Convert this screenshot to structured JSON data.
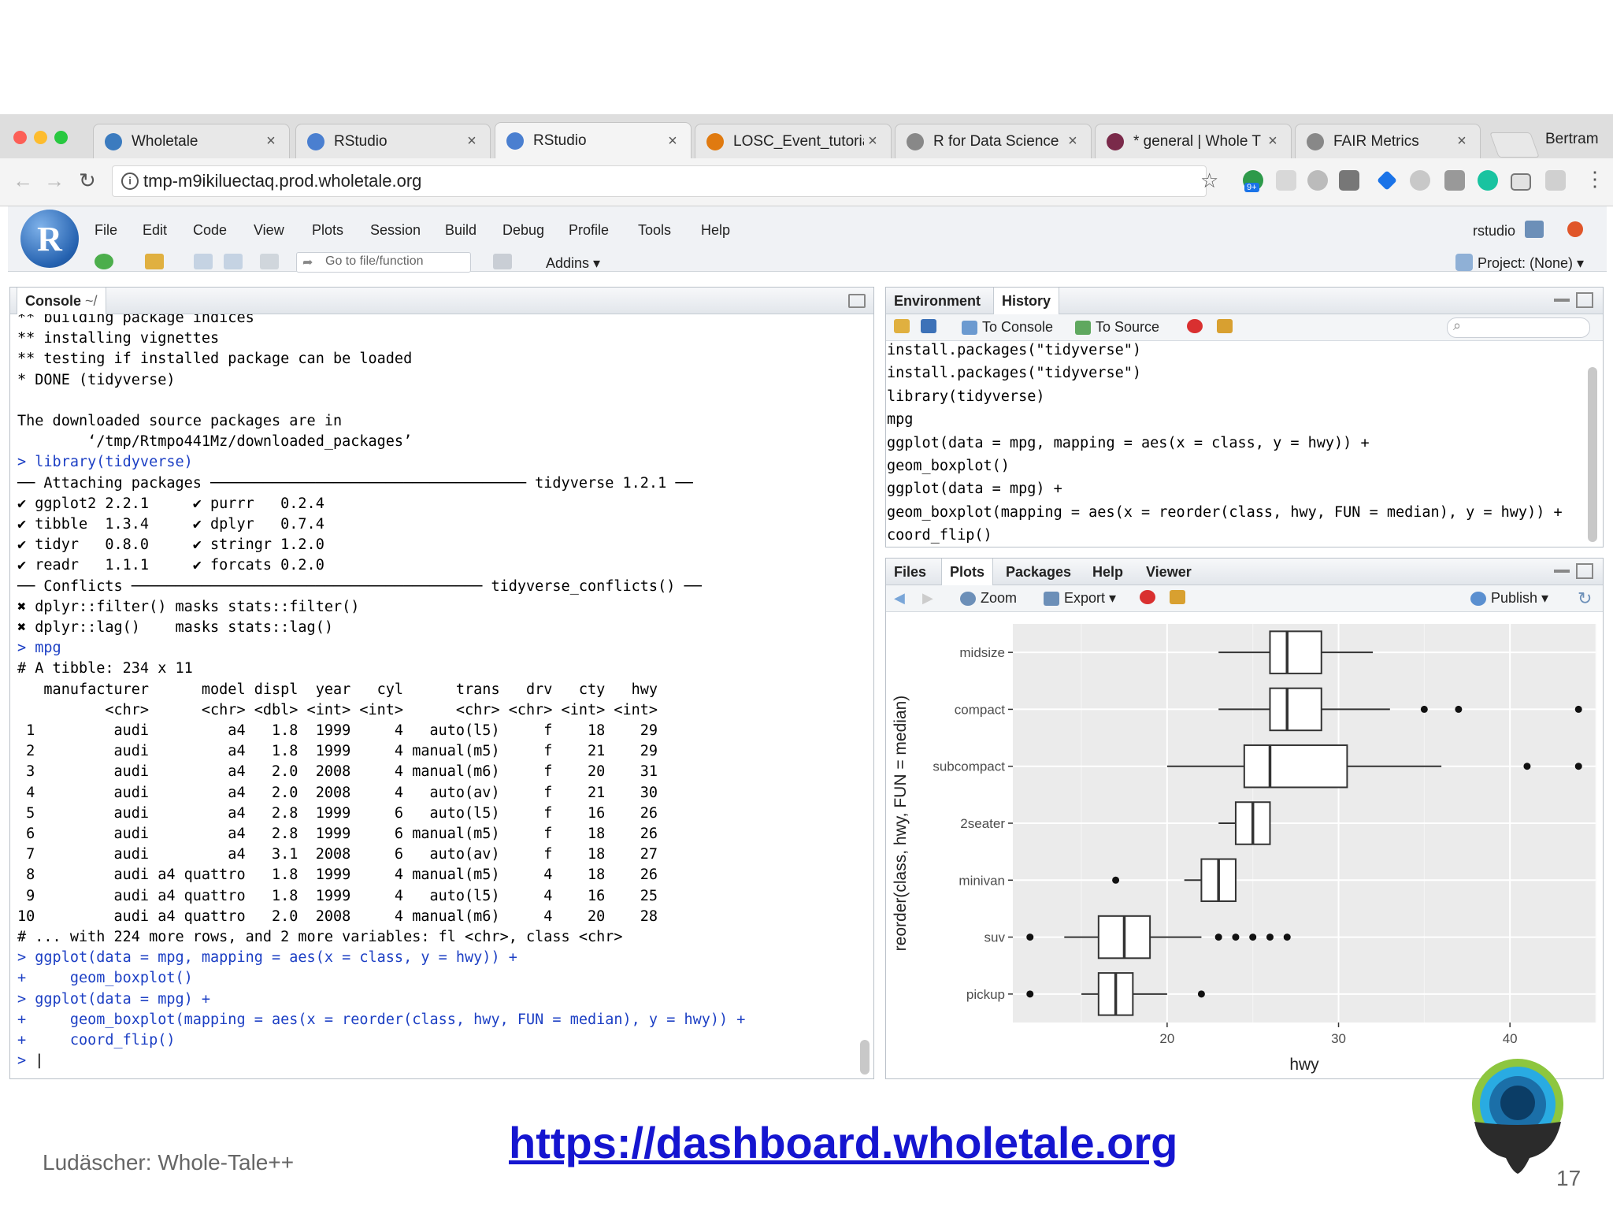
{
  "browser": {
    "tabs": [
      {
        "title": "Wholetale",
        "icon": "globe-icon",
        "color": "#3b7bbf"
      },
      {
        "title": "RStudio",
        "icon": "rstudio-icon",
        "color": "#4a7fd0"
      },
      {
        "title": "RStudio",
        "icon": "rstudio-icon",
        "color": "#4a7fd0"
      },
      {
        "title": "LOSC_Event_tutoria",
        "icon": "notebook-icon",
        "color": "#e07a10"
      },
      {
        "title": "R for Data Science",
        "icon": "document-icon",
        "color": "#888888"
      },
      {
        "title": "* general | Whole T",
        "icon": "slack-icon",
        "color": "#7a2a4a"
      },
      {
        "title": "FAIR Metrics",
        "icon": "document-icon",
        "color": "#888888"
      }
    ],
    "close_glyph": "×",
    "profile_name": "Bertram",
    "url": "tmp-m9ikiluectaq.prod.wholetale.org",
    "ext_badge": "9+"
  },
  "rstudio": {
    "logo_letter": "R",
    "menus": [
      "File",
      "Edit",
      "Code",
      "View",
      "Plots",
      "Session",
      "Build",
      "Debug",
      "Profile",
      "Tools",
      "Help"
    ],
    "goto_placeholder": "Go to file/function",
    "addins_label": "Addins",
    "user": "rstudio",
    "project_label": "Project: (None)"
  },
  "console": {
    "tab_label": "Console",
    "path": "~/",
    "lines": [
      {
        "t": "** building package indices",
        "c": false
      },
      {
        "t": "** installing vignettes",
        "c": false
      },
      {
        "t": "** testing if installed package can be loaded",
        "c": false
      },
      {
        "t": "* DONE (tidyverse)",
        "c": false
      },
      {
        "t": "",
        "c": false
      },
      {
        "t": "The downloaded source packages are in",
        "c": false
      },
      {
        "t": "        ‘/tmp/Rtmpo441Mz/downloaded_packages’",
        "c": false
      },
      {
        "t": "> library(tidyverse)",
        "c": true
      },
      {
        "t": "── Attaching packages ──────────────────────────────────── tidyverse 1.2.1 ──",
        "c": false
      },
      {
        "t": "✔ ggplot2 2.2.1     ✔ purrr   0.2.4",
        "c": false
      },
      {
        "t": "✔ tibble  1.3.4     ✔ dplyr   0.7.4",
        "c": false
      },
      {
        "t": "✔ tidyr   0.8.0     ✔ stringr 1.2.0",
        "c": false
      },
      {
        "t": "✔ readr   1.1.1     ✔ forcats 0.2.0",
        "c": false
      },
      {
        "t": "── Conflicts ──────────────────────────────────────── tidyverse_conflicts() ──",
        "c": false
      },
      {
        "t": "✖ dplyr::filter() masks stats::filter()",
        "c": false
      },
      {
        "t": "✖ dplyr::lag()    masks stats::lag()",
        "c": false
      },
      {
        "t": "> mpg",
        "c": true
      },
      {
        "t": "# A tibble: 234 x 11",
        "c": false
      },
      {
        "t": "   manufacturer      model displ  year   cyl      trans   drv   cty   hwy",
        "c": false
      },
      {
        "t": "          <chr>      <chr> <dbl> <int> <int>      <chr> <chr> <int> <int>",
        "c": false
      },
      {
        "t": " 1         audi         a4   1.8  1999     4   auto(l5)     f    18    29",
        "c": false
      },
      {
        "t": " 2         audi         a4   1.8  1999     4 manual(m5)     f    21    29",
        "c": false
      },
      {
        "t": " 3         audi         a4   2.0  2008     4 manual(m6)     f    20    31",
        "c": false
      },
      {
        "t": " 4         audi         a4   2.0  2008     4   auto(av)     f    21    30",
        "c": false
      },
      {
        "t": " 5         audi         a4   2.8  1999     6   auto(l5)     f    16    26",
        "c": false
      },
      {
        "t": " 6         audi         a4   2.8  1999     6 manual(m5)     f    18    26",
        "c": false
      },
      {
        "t": " 7         audi         a4   3.1  2008     6   auto(av)     f    18    27",
        "c": false
      },
      {
        "t": " 8         audi a4 quattro   1.8  1999     4 manual(m5)     4    18    26",
        "c": false
      },
      {
        "t": " 9         audi a4 quattro   1.8  1999     4   auto(l5)     4    16    25",
        "c": false
      },
      {
        "t": "10         audi a4 quattro   2.0  2008     4 manual(m6)     4    20    28",
        "c": false
      },
      {
        "t": "# ... with 224 more rows, and 2 more variables: fl <chr>, class <chr>",
        "c": false
      },
      {
        "t": "> ggplot(data = mpg, mapping = aes(x = class, y = hwy)) +",
        "c": true
      },
      {
        "t": "+     geom_boxplot()",
        "c": true
      },
      {
        "t": "> ggplot(data = mpg) +",
        "c": true
      },
      {
        "t": "+     geom_boxplot(mapping = aes(x = reorder(class, hwy, FUN = median), y = hwy)) +",
        "c": true
      },
      {
        "t": "+     coord_flip()",
        "c": true
      },
      {
        "t": "> ",
        "c": true
      }
    ]
  },
  "env_pane": {
    "tabs": [
      "Environment",
      "History"
    ],
    "to_console": "To Console",
    "to_source": "To Source",
    "history": [
      "install.packages(\"tidyverse\")",
      "install.packages(\"tidyverse\")",
      "library(tidyverse)",
      "mpg",
      "ggplot(data = mpg, mapping = aes(x = class, y = hwy)) +",
      "geom_boxplot()",
      "ggplot(data = mpg) +",
      "geom_boxplot(mapping = aes(x = reorder(class, hwy, FUN = median), y = hwy)) +",
      "coord_flip()"
    ]
  },
  "files_pane": {
    "tabs": [
      "Files",
      "Plots",
      "Packages",
      "Help",
      "Viewer"
    ],
    "zoom": "Zoom",
    "export": "Export",
    "publish": "Publish"
  },
  "chart_data": {
    "type": "boxplot",
    "orientation": "horizontal",
    "xlabel": "hwy",
    "ylabel": "reorder(class, hwy, FUN = median)",
    "xlim": [
      11,
      45
    ],
    "xticks": [
      20,
      30,
      40
    ],
    "grid": true,
    "categories": [
      "midsize",
      "compact",
      "subcompact",
      "2seater",
      "minivan",
      "suv",
      "pickup"
    ],
    "boxes": [
      {
        "name": "midsize",
        "whisker_low": 23,
        "q1": 26,
        "median": 27,
        "q3": 29,
        "whisker_high": 32,
        "outliers": []
      },
      {
        "name": "compact",
        "whisker_low": 23,
        "q1": 26,
        "median": 27,
        "q3": 29,
        "whisker_high": 33,
        "outliers": [
          35,
          37,
          44
        ]
      },
      {
        "name": "subcompact",
        "whisker_low": 20,
        "q1": 24.5,
        "median": 26,
        "q3": 30.5,
        "whisker_high": 36,
        "outliers": [
          41,
          44
        ]
      },
      {
        "name": "2seater",
        "whisker_low": 23,
        "q1": 24,
        "median": 25,
        "q3": 26,
        "whisker_high": 26,
        "outliers": []
      },
      {
        "name": "minivan",
        "whisker_low": 21,
        "q1": 22,
        "median": 23,
        "q3": 24,
        "whisker_high": 24,
        "outliers": [
          17
        ]
      },
      {
        "name": "suv",
        "whisker_low": 14,
        "q1": 16,
        "median": 17.5,
        "q3": 19,
        "whisker_high": 22,
        "outliers": [
          12,
          23,
          24,
          25,
          26,
          27
        ]
      },
      {
        "name": "pickup",
        "whisker_low": 15,
        "q1": 16,
        "median": 17,
        "q3": 18,
        "whisker_high": 20,
        "outliers": [
          12,
          22
        ]
      }
    ]
  },
  "footer": {
    "left": "Ludäscher: Whole-Tale++",
    "link": "https://dashboard.wholetale.org",
    "page": "17"
  }
}
